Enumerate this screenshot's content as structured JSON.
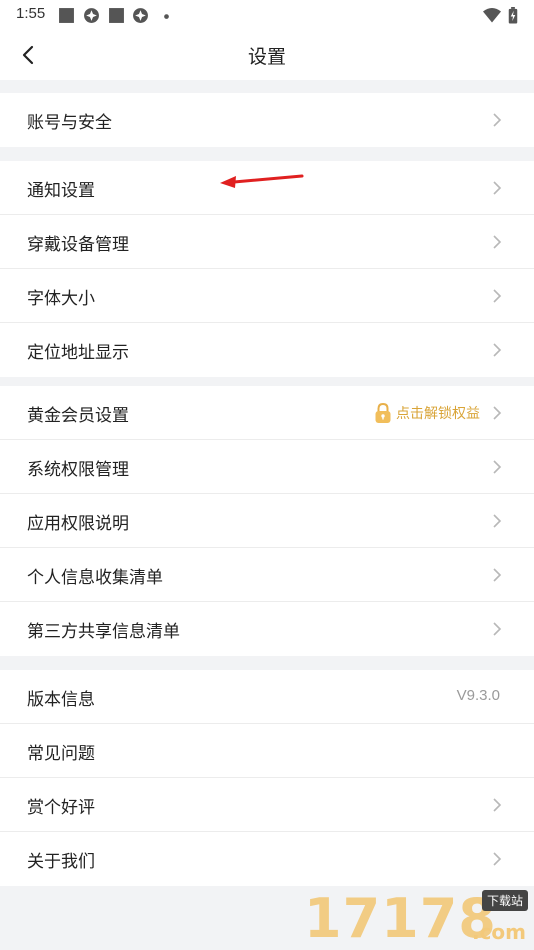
{
  "status_bar": {
    "time": "1:55",
    "left_icons": [
      "square-icon",
      "pinwheel-icon",
      "square-icon",
      "pinwheel-icon",
      "dot-icon"
    ],
    "right_icons": [
      "wifi-icon",
      "battery-charging-icon"
    ]
  },
  "header": {
    "title": "设置",
    "back_icon": "chevron-left-icon"
  },
  "sections": [
    {
      "rows": [
        {
          "label": "账号与安全",
          "chevron": true
        }
      ]
    },
    {
      "rows": [
        {
          "label": "通知设置",
          "chevron": true
        },
        {
          "label": "穿戴设备管理",
          "chevron": true
        },
        {
          "label": "字体大小",
          "chevron": true
        },
        {
          "label": "定位地址显示",
          "chevron": true
        }
      ]
    },
    {
      "rows": [
        {
          "label": "黄金会员设置",
          "chevron": true,
          "promo": "点击解锁权益"
        },
        {
          "label": "系统权限管理",
          "chevron": true
        },
        {
          "label": "应用权限说明",
          "chevron": true
        },
        {
          "label": "个人信息收集清单",
          "chevron": true
        },
        {
          "label": "第三方共享信息清单",
          "chevron": true
        }
      ]
    },
    {
      "rows": [
        {
          "label": "版本信息",
          "chevron": false,
          "value": "V9.3.0"
        },
        {
          "label": "常见问题",
          "chevron": false
        },
        {
          "label": "赏个好评",
          "chevron": true
        },
        {
          "label": "关于我们",
          "chevron": true
        }
      ]
    }
  ],
  "watermark": {
    "number": "17178",
    "badge": "下载站",
    "suffix": ".com"
  },
  "colors": {
    "background": "#f2f3f5",
    "surface": "#ffffff",
    "text": "#222222",
    "secondary_text": "#9a9a9a",
    "chevron": "#b8b8b8",
    "promo": "#d9a437",
    "annotation_arrow": "#e02020"
  }
}
